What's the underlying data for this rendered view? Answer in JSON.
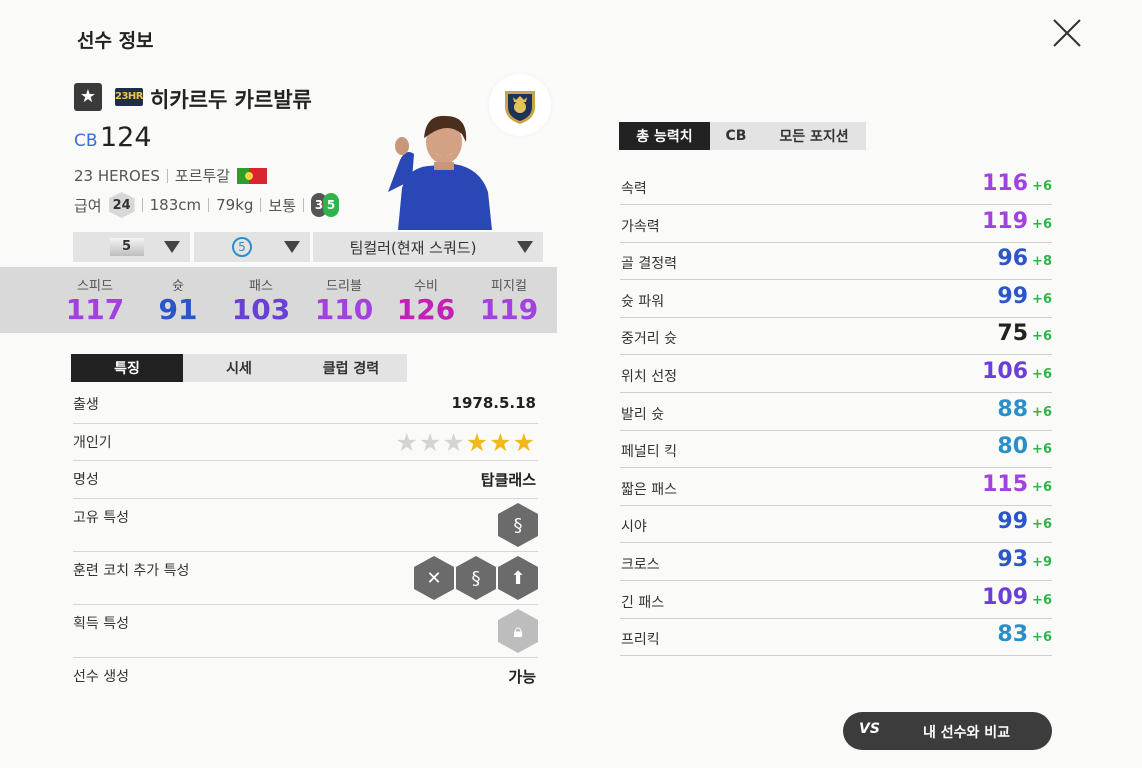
{
  "header": {
    "title": "선수 정보",
    "close_icon": "close-icon"
  },
  "player": {
    "season_badge": "23HR",
    "name": "히카르두 카르발류",
    "position": "CB",
    "overall": "124",
    "season_name": "23 HEROES",
    "nation": "포르투갈",
    "pay_label": "급여",
    "pay": "24",
    "height": "183cm",
    "weight": "79kg",
    "body_type": "보통",
    "weak_foot_left": "3",
    "weak_foot_right": "5"
  },
  "selectors": [
    {
      "value": "5"
    },
    {
      "value": "5"
    },
    {
      "value": "팀컬러(현재 스쿼드)"
    }
  ],
  "summary_stats": [
    {
      "label": "스피드",
      "value": "117",
      "color": "#a240e0"
    },
    {
      "label": "슛",
      "value": "91",
      "color": "#2a56c9"
    },
    {
      "label": "패스",
      "value": "103",
      "color": "#6a3fd8"
    },
    {
      "label": "드리블",
      "value": "110",
      "color": "#a240e0"
    },
    {
      "label": "수비",
      "value": "126",
      "color": "#c320b5"
    },
    {
      "label": "피지컬",
      "value": "119",
      "color": "#a240e0"
    }
  ],
  "left_tabs": [
    "특징",
    "시세",
    "클럽 경력"
  ],
  "features": {
    "birth_label": "출생",
    "birth": "1978.5.18",
    "popularity_label": "개인기",
    "popularity_stars_on": 3,
    "popularity_stars_total": 6,
    "reputation_label": "명성",
    "reputation": "탑클래스",
    "unique_trait_label": "고유 특성",
    "coach_trait_label": "훈련 코치 추가 특성",
    "acquired_trait_label": "획득 특성",
    "creation_label": "선수 생성",
    "creation": "가능"
  },
  "right_tabs": [
    "총 능력치",
    "CB",
    "모든 포지션"
  ],
  "attributes": [
    {
      "name": "속력",
      "value": "116",
      "bonus": "+6",
      "color": "#a240e0"
    },
    {
      "name": "가속력",
      "value": "119",
      "bonus": "+6",
      "color": "#a240e0"
    },
    {
      "name": "골 결정력",
      "value": "96",
      "bonus": "+8",
      "color": "#2a56c9"
    },
    {
      "name": "슛 파워",
      "value": "99",
      "bonus": "+6",
      "color": "#2a56c9"
    },
    {
      "name": "중거리 슛",
      "value": "75",
      "bonus": "+6",
      "color": "#222222"
    },
    {
      "name": "위치 선정",
      "value": "106",
      "bonus": "+6",
      "color": "#6a3fd8"
    },
    {
      "name": "발리 슛",
      "value": "88",
      "bonus": "+6",
      "color": "#2a8fc9"
    },
    {
      "name": "페널티 킥",
      "value": "80",
      "bonus": "+6",
      "color": "#2a8fc9"
    },
    {
      "name": "짧은 패스",
      "value": "115",
      "bonus": "+6",
      "color": "#a240e0"
    },
    {
      "name": "시야",
      "value": "99",
      "bonus": "+6",
      "color": "#2a56c9"
    },
    {
      "name": "크로스",
      "value": "93",
      "bonus": "+9",
      "color": "#2a56c9"
    },
    {
      "name": "긴 패스",
      "value": "109",
      "bonus": "+6",
      "color": "#6a3fd8"
    },
    {
      "name": "프리킥",
      "value": "83",
      "bonus": "+6",
      "color": "#2a8fc9"
    }
  ],
  "compare": {
    "vs": "VS",
    "label": "내 선수와 비교"
  }
}
